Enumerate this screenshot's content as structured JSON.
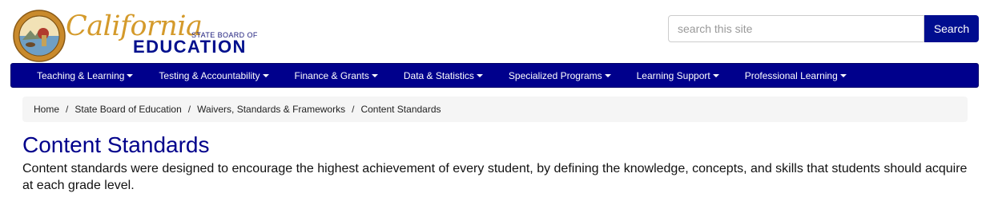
{
  "header": {
    "logo": {
      "california": "California",
      "state_board": "STATE BOARD OF",
      "education": "EDUCATION"
    },
    "search": {
      "placeholder": "search this site",
      "value": "",
      "button_label": "Search"
    }
  },
  "nav": {
    "items": [
      {
        "label": "Teaching & Learning"
      },
      {
        "label": "Testing & Accountability"
      },
      {
        "label": "Finance & Grants"
      },
      {
        "label": "Data & Statistics"
      },
      {
        "label": "Specialized Programs"
      },
      {
        "label": "Learning Support"
      },
      {
        "label": "Professional Learning"
      }
    ]
  },
  "breadcrumb": {
    "items": [
      {
        "label": "Home"
      },
      {
        "label": "State Board of Education"
      },
      {
        "label": "Waivers, Standards & Frameworks"
      },
      {
        "label": "Content Standards"
      }
    ],
    "separator": "/"
  },
  "main": {
    "title": "Content Standards",
    "intro": "Content standards were designed to encourage the highest achievement of every student, by defining the knowledge, concepts, and skills that students should acquire at each grade level."
  },
  "colors": {
    "nav_background": "#00008c",
    "search_button": "#000d8f",
    "title": "#00008b",
    "logo_gold": "#d49a2b",
    "logo_blue": "#00108d",
    "breadcrumb_background": "#f5f5f5"
  }
}
